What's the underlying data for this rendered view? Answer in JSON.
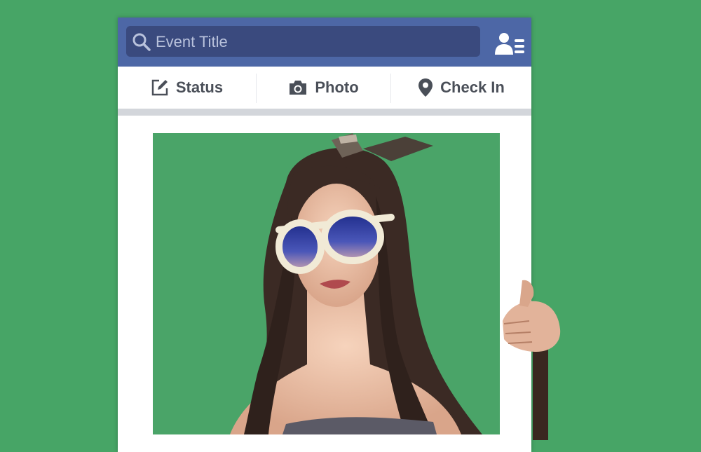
{
  "search": {
    "placeholder": "Event Title",
    "icon": "search-icon"
  },
  "header": {
    "friends_icon": "friends-icon"
  },
  "tabs": [
    {
      "label": "Status",
      "icon": "edit-icon"
    },
    {
      "label": "Photo",
      "icon": "camera-icon"
    },
    {
      "label": "Check In",
      "icon": "location-pin-icon"
    }
  ],
  "colors": {
    "background": "#47a566",
    "topbar": "#4d67a6",
    "search_field": "#3a4a7e",
    "tab_text": "#4a4f58",
    "divider": "#d3d6db"
  }
}
